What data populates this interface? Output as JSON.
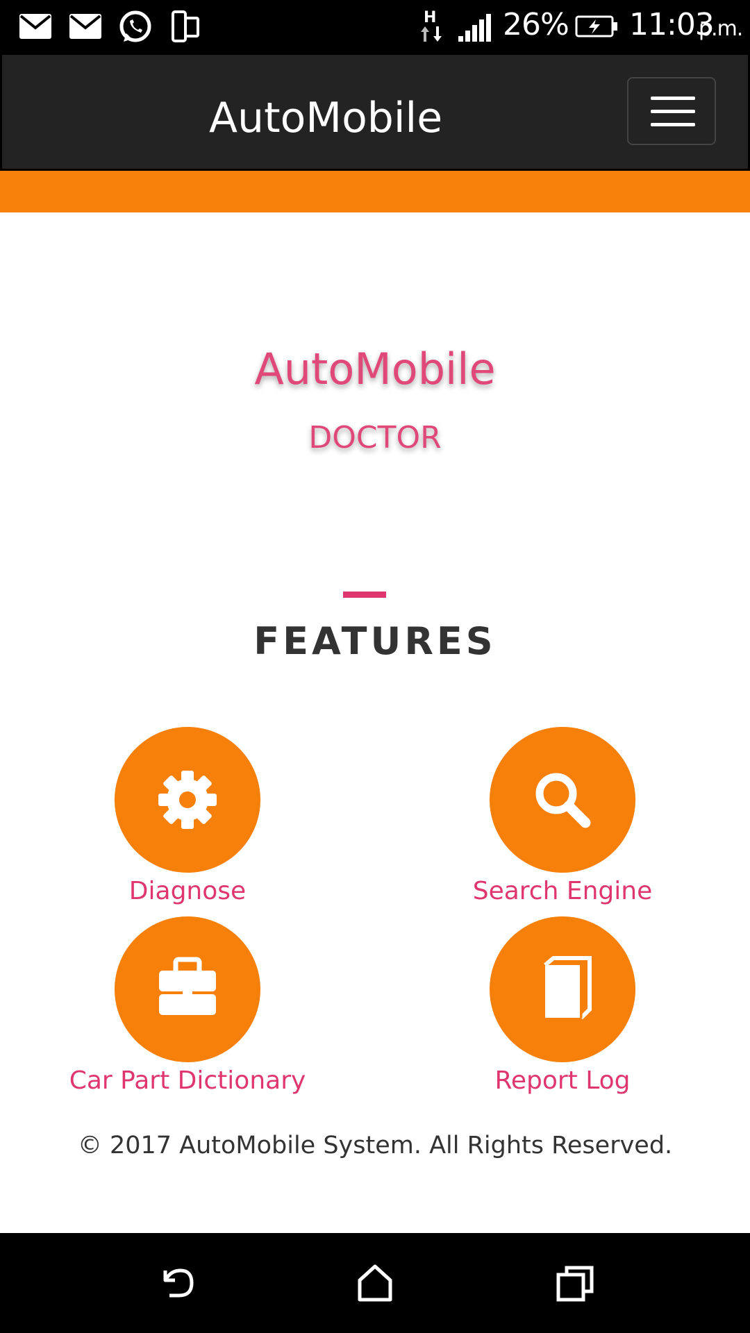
{
  "status_bar": {
    "icons": [
      "mail-icon",
      "mail-icon",
      "whatsapp-icon",
      "screen-rotate-icon",
      "network-h-icon",
      "signal-icon",
      "battery-charging-icon"
    ],
    "battery": "26%",
    "time": "11:03",
    "time_suffix": "p.m."
  },
  "app_bar": {
    "brand": "AutoMobile",
    "menu_icon": "hamburger-menu-icon"
  },
  "hero": {
    "title": "AutoMobile",
    "subtitle": "DOCTOR"
  },
  "features": {
    "heading": "FEATURES",
    "items": [
      {
        "label": "Diagnose",
        "icon": "gear-icon"
      },
      {
        "label": "Search Engine",
        "icon": "search-icon"
      },
      {
        "label": "Car Part Dictionary",
        "icon": "briefcase-icon"
      },
      {
        "label": "Report Log",
        "icon": "book-icon"
      }
    ]
  },
  "footer": {
    "text": "© 2017 AutoMobile System. All Rights Reserved."
  },
  "nav_bar": {
    "icons": [
      "back-icon",
      "home-icon",
      "recents-icon"
    ]
  },
  "colors": {
    "accent_orange": "#f7800a",
    "accent_pink": "#e0366f",
    "app_bar": "#232323"
  }
}
